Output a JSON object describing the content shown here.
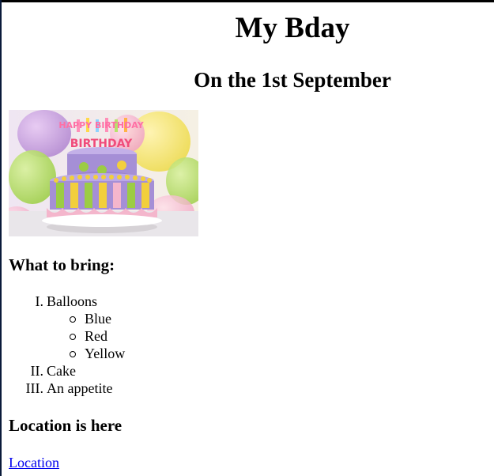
{
  "page": {
    "title": "My Bday",
    "subtitle": "On the 1st September"
  },
  "image": {
    "alt": "Happy Birthday cake",
    "topper_text": "HAPPY BIRTHDAY"
  },
  "bring": {
    "heading": "What to bring:",
    "items": [
      {
        "numeral": "I.",
        "label": "Balloons",
        "sub": [
          "Blue",
          "Red",
          "Yellow"
        ]
      },
      {
        "numeral": "II.",
        "label": "Cake"
      },
      {
        "numeral": "III.",
        "label": "An appetite"
      }
    ]
  },
  "location": {
    "heading": "Location is here",
    "link_text": "Location"
  },
  "colors": {
    "link": "#0000ee",
    "cake_lavender": "#a58fd6",
    "cake_pink": "#f4b6cc",
    "frosting_yellow": "#f2cf3c"
  }
}
